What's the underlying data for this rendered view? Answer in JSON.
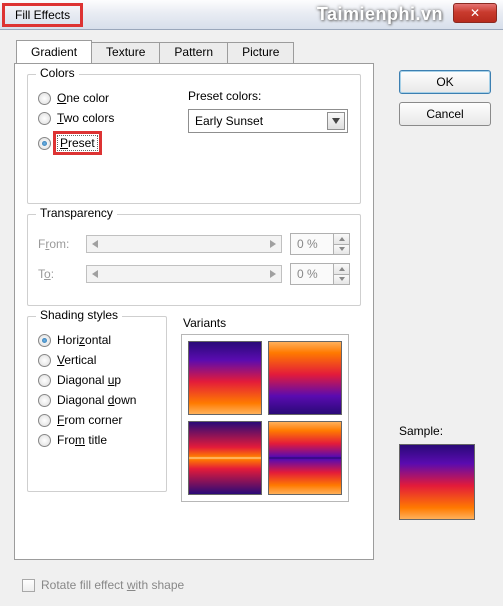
{
  "window": {
    "title": "Fill Effects",
    "watermark": "Taimienphi.vn"
  },
  "tabs": {
    "gradient": "Gradient",
    "texture": "Texture",
    "pattern": "Pattern",
    "picture": "Picture"
  },
  "buttons": {
    "ok": "OK",
    "cancel": "Cancel"
  },
  "colors": {
    "legend": "Colors",
    "one": "One color",
    "two": "Two colors",
    "preset": "Preset",
    "preset_colors_label": "Preset colors:",
    "preset_selected": "Early Sunset"
  },
  "transparency": {
    "legend": "Transparency",
    "from_label": "From:",
    "to_label": "To:",
    "from_value": "0 %",
    "to_value": "0 %"
  },
  "shading": {
    "legend": "Shading styles",
    "horizontal": "Horizontal",
    "vertical": "Vertical",
    "diagup": "Diagonal up",
    "diagdown": "Diagonal down",
    "corner": "From corner",
    "title": "From title"
  },
  "variants_label": "Variants",
  "sample_label": "Sample:",
  "rotate_label": "Rotate fill effect with shape"
}
